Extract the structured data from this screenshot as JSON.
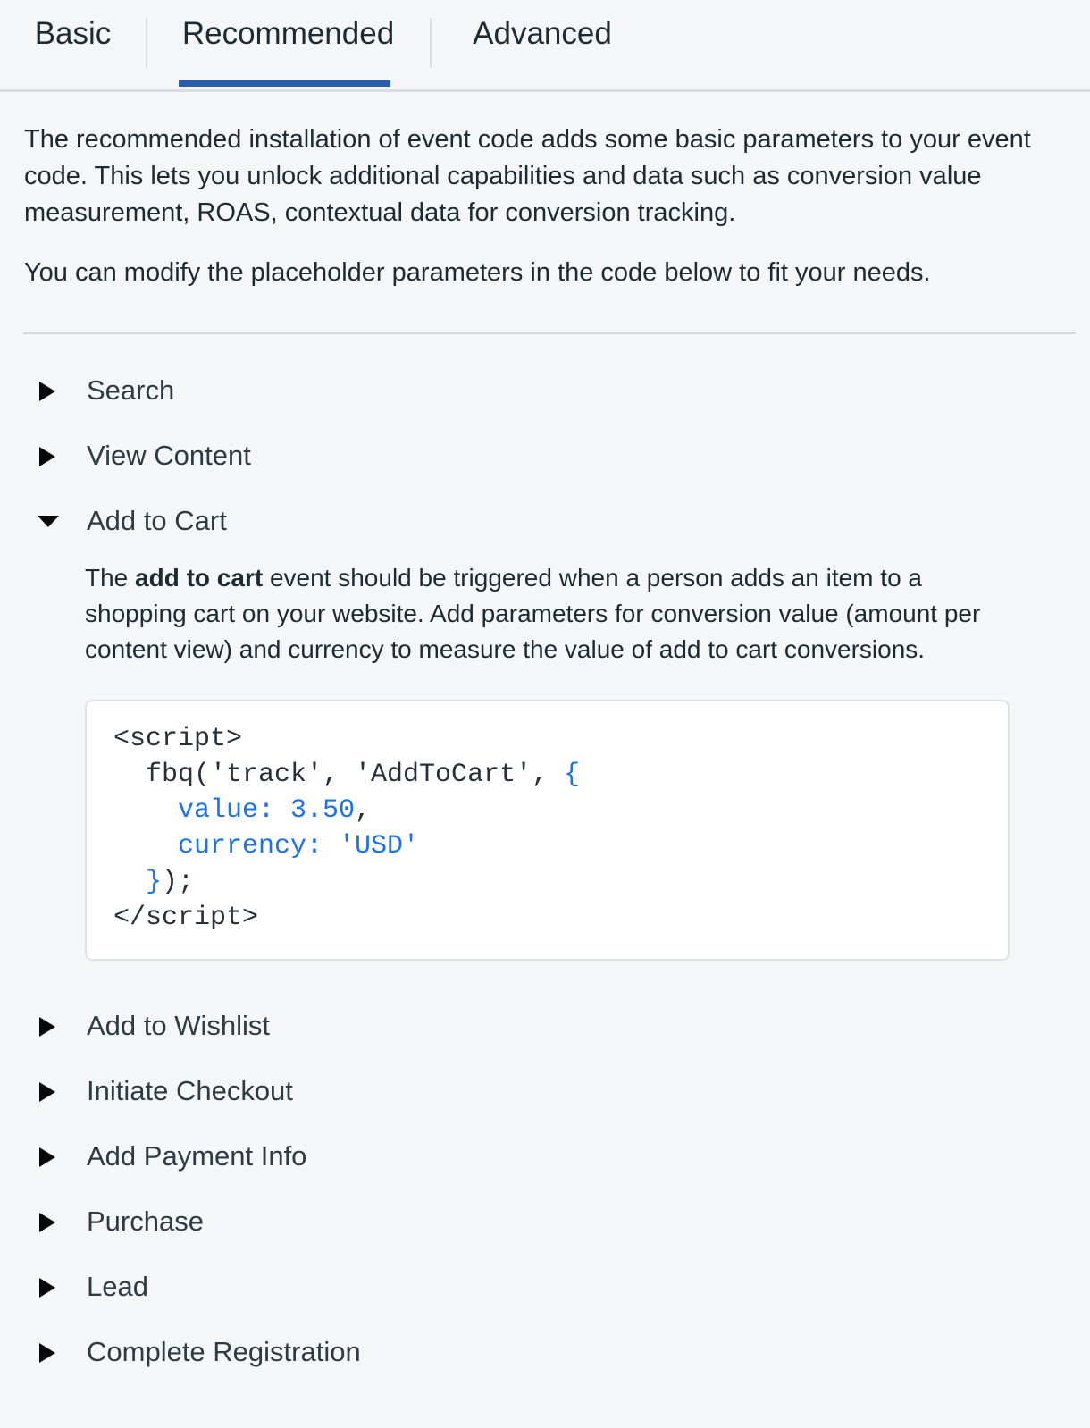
{
  "tabs": [
    {
      "id": "basic",
      "label": "Basic",
      "selected": false
    },
    {
      "id": "recommended",
      "label": "Recommended",
      "selected": true
    },
    {
      "id": "advanced",
      "label": "Advanced",
      "selected": false
    }
  ],
  "colors": {
    "accent": "#2a5db0",
    "page_background": "#f5f6f7",
    "text": "#1c2b33",
    "code_keyword_blue": "#1d72e8",
    "divider": "#d4d6da"
  },
  "intro": {
    "paragraph_1": "The recommended installation of event code adds some basic parameters to your event code. This lets you unlock additional capabilities and data such as conversion value measurement, ROAS, contextual data for conversion tracking.",
    "paragraph_2": "You can modify the placeholder parameters in the code below to fit your needs."
  },
  "events": [
    {
      "id": "search",
      "label": "Search",
      "expanded": false
    },
    {
      "id": "view-content",
      "label": "View Content",
      "expanded": false
    },
    {
      "id": "add-to-cart",
      "label": "Add to Cart",
      "expanded": true
    },
    {
      "id": "add-to-wishlist",
      "label": "Add to Wishlist",
      "expanded": false
    },
    {
      "id": "initiate-checkout",
      "label": "Initiate Checkout",
      "expanded": false
    },
    {
      "id": "add-payment-info",
      "label": "Add Payment Info",
      "expanded": false
    },
    {
      "id": "purchase",
      "label": "Purchase",
      "expanded": false
    },
    {
      "id": "lead",
      "label": "Lead",
      "expanded": false
    },
    {
      "id": "complete-registration",
      "label": "Complete Registration",
      "expanded": false
    }
  ],
  "add_to_cart": {
    "description_before": "The ",
    "description_bold": "add to cart",
    "description_after": " event should be triggered when a person adds an item to a shopping cart on your website. Add parameters for conversion value (amount per content view) and currency to measure the value of add to cart conversions.",
    "code": {
      "line_1": "<script>",
      "line_2_plain": "  fbq('track', 'AddToCart', ",
      "line_2_blue": "{",
      "line_3_blue": "    value: 3.50",
      "line_3_plain": ",",
      "line_4_blue": "    currency: 'USD'",
      "line_5_blue": "  }",
      "line_5_plain": ");",
      "line_6": "</script>"
    }
  },
  "icons": {
    "caret_collapsed": "caret-right-icon",
    "caret_expanded": "caret-down-icon"
  }
}
